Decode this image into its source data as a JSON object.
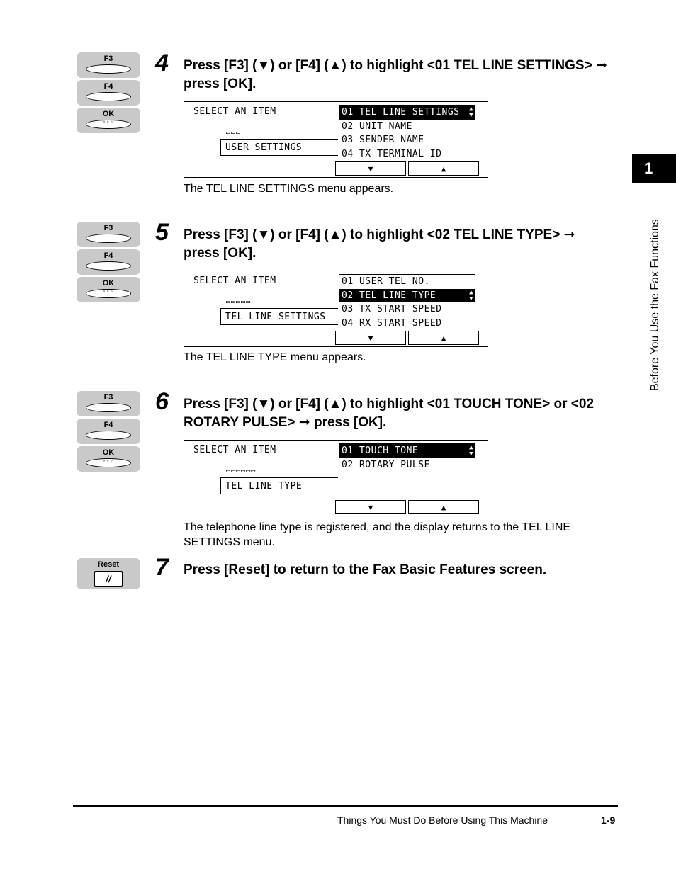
{
  "side_tab": {
    "chapter": "1",
    "title": "Before You Use the Fax Functions"
  },
  "keys": {
    "f3": "F3",
    "f4": "F4",
    "ok": "OK",
    "ok_dots": "◦◦◦",
    "reset": "Reset",
    "reset_symbol": "//"
  },
  "steps": [
    {
      "number": "4",
      "instruction": "Press [F3] (▼) or [F4] (▲) to highlight <01 TEL LINE SETTINGS> ➞ press [OK].",
      "lcd": {
        "title": "SELECT AN ITEM",
        "boxes": "▭▭▭",
        "context": "USER SETTINGS",
        "items": [
          "01 TEL LINE SETTINGS",
          "02 UNIT NAME",
          "03 SENDER NAME",
          "04 TX TERMINAL ID"
        ],
        "highlighted": 0
      },
      "caption": "The TEL LINE SETTINGS menu appears."
    },
    {
      "number": "5",
      "instruction": "Press [F3] (▼) or [F4] (▲) to highlight <02 TEL LINE TYPE> ➞ press [OK].",
      "lcd": {
        "title": "SELECT AN ITEM",
        "boxes": "▭▭▭▭▭",
        "context": "TEL LINE SETTINGS",
        "items": [
          "01 USER TEL NO.",
          "02 TEL LINE TYPE",
          "03 TX START SPEED",
          "04 RX START SPEED"
        ],
        "highlighted": 1
      },
      "caption": "The TEL LINE TYPE menu appears."
    },
    {
      "number": "6",
      "instruction": "Press [F3] (▼) or [F4] (▲) to highlight <01 TOUCH TONE> or <02 ROTARY PULSE> ➞ press [OK].",
      "lcd": {
        "title": "SELECT AN ITEM",
        "boxes": "▭▭▭▭▭▭",
        "context": "TEL LINE TYPE",
        "items": [
          "01 TOUCH TONE",
          "02 ROTARY PULSE"
        ],
        "highlighted": 0
      },
      "caption": "The telephone line type is registered, and the display returns to the TEL LINE SETTINGS menu."
    },
    {
      "number": "7",
      "instruction": "Press [Reset] to return to the Fax Basic Features screen."
    }
  ],
  "lcd_nav": {
    "down": "▼",
    "up": "▲",
    "scroll": "▲▼"
  },
  "footer": {
    "text": "Things You Must Do Before Using This Machine",
    "page": "1-9"
  }
}
